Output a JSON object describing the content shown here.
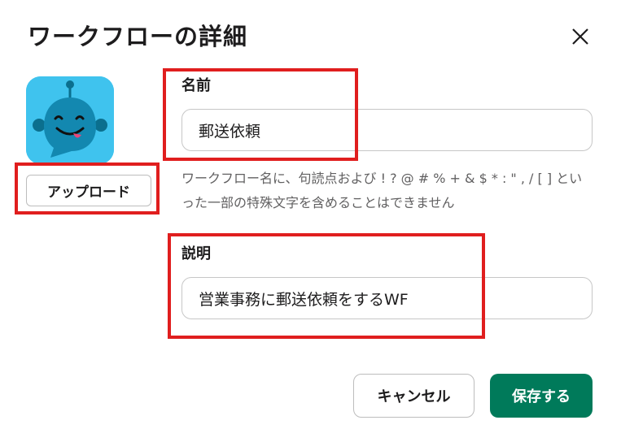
{
  "dialog": {
    "title": "ワークフローの詳細",
    "close_icon": "close-icon"
  },
  "avatar": {
    "icon": "robot-face-icon",
    "upload_label": "アップロード",
    "bg_color": "#3fc3ee"
  },
  "name_field": {
    "label": "名前",
    "value": "郵送依頼",
    "hint": "ワークフロー名に、句読点および ! ? @ # % + & $ * : \" , / [ ] といった一部の特殊文字を含めることはできません"
  },
  "description_field": {
    "label": "説明",
    "value": "営業事務に郵送依頼をするWF"
  },
  "footer": {
    "cancel_label": "キャンセル",
    "save_label": "保存する",
    "save_color": "#007a5a"
  },
  "annotation_color": "#e01e1e"
}
